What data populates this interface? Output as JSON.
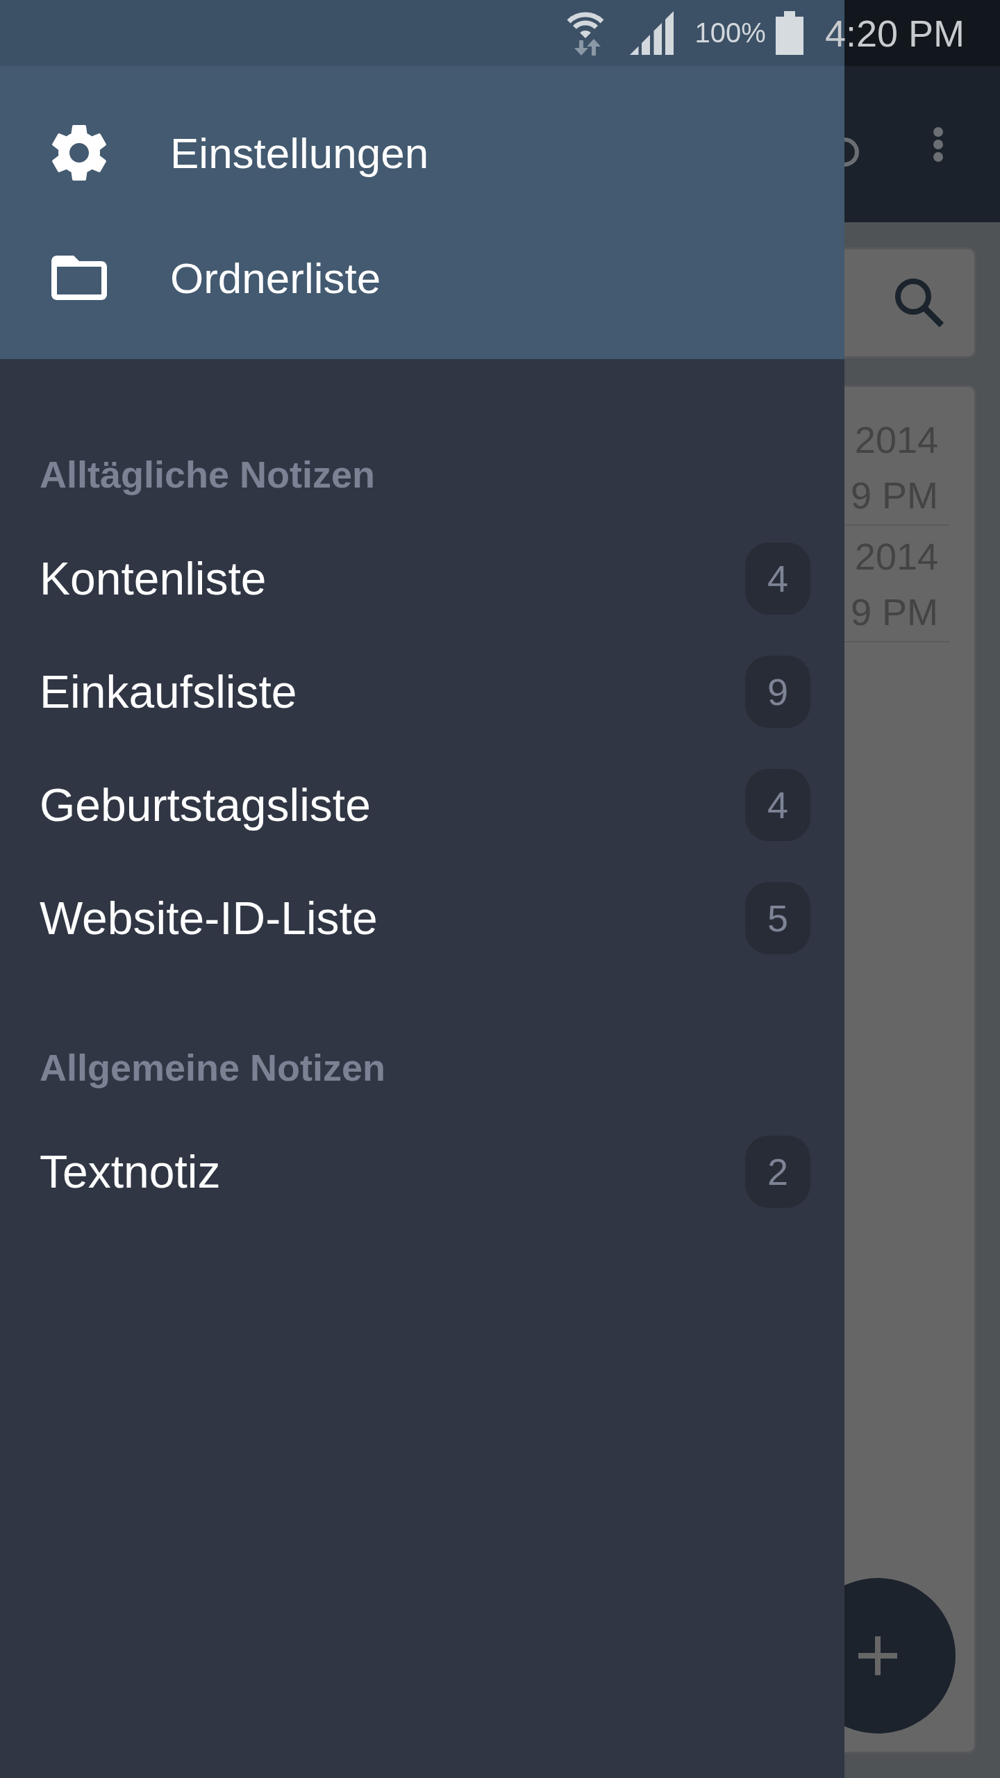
{
  "status_bar": {
    "battery": "100%",
    "time": "4:20 PM"
  },
  "drawer": {
    "header_items": [
      {
        "kind": "settings",
        "label": "Einstellungen"
      },
      {
        "kind": "folder",
        "label": "Ordnerliste"
      }
    ],
    "sections": [
      {
        "title": "Alltägliche Notizen",
        "items": [
          {
            "label": "Kontenliste",
            "count": "4"
          },
          {
            "label": "Einkaufsliste",
            "count": "9"
          },
          {
            "label": "Geburtstagsliste",
            "count": "4"
          },
          {
            "label": "Website-ID-Liste",
            "count": "5"
          }
        ]
      },
      {
        "title": "Allgemeine Notizen",
        "items": [
          {
            "label": "Textnotiz",
            "count": "2"
          }
        ]
      }
    ]
  },
  "background_app": {
    "notes": [
      {
        "lines": [
          "2014",
          "9 PM"
        ]
      },
      {
        "lines": [
          "2014",
          "9 PM"
        ]
      }
    ]
  }
}
